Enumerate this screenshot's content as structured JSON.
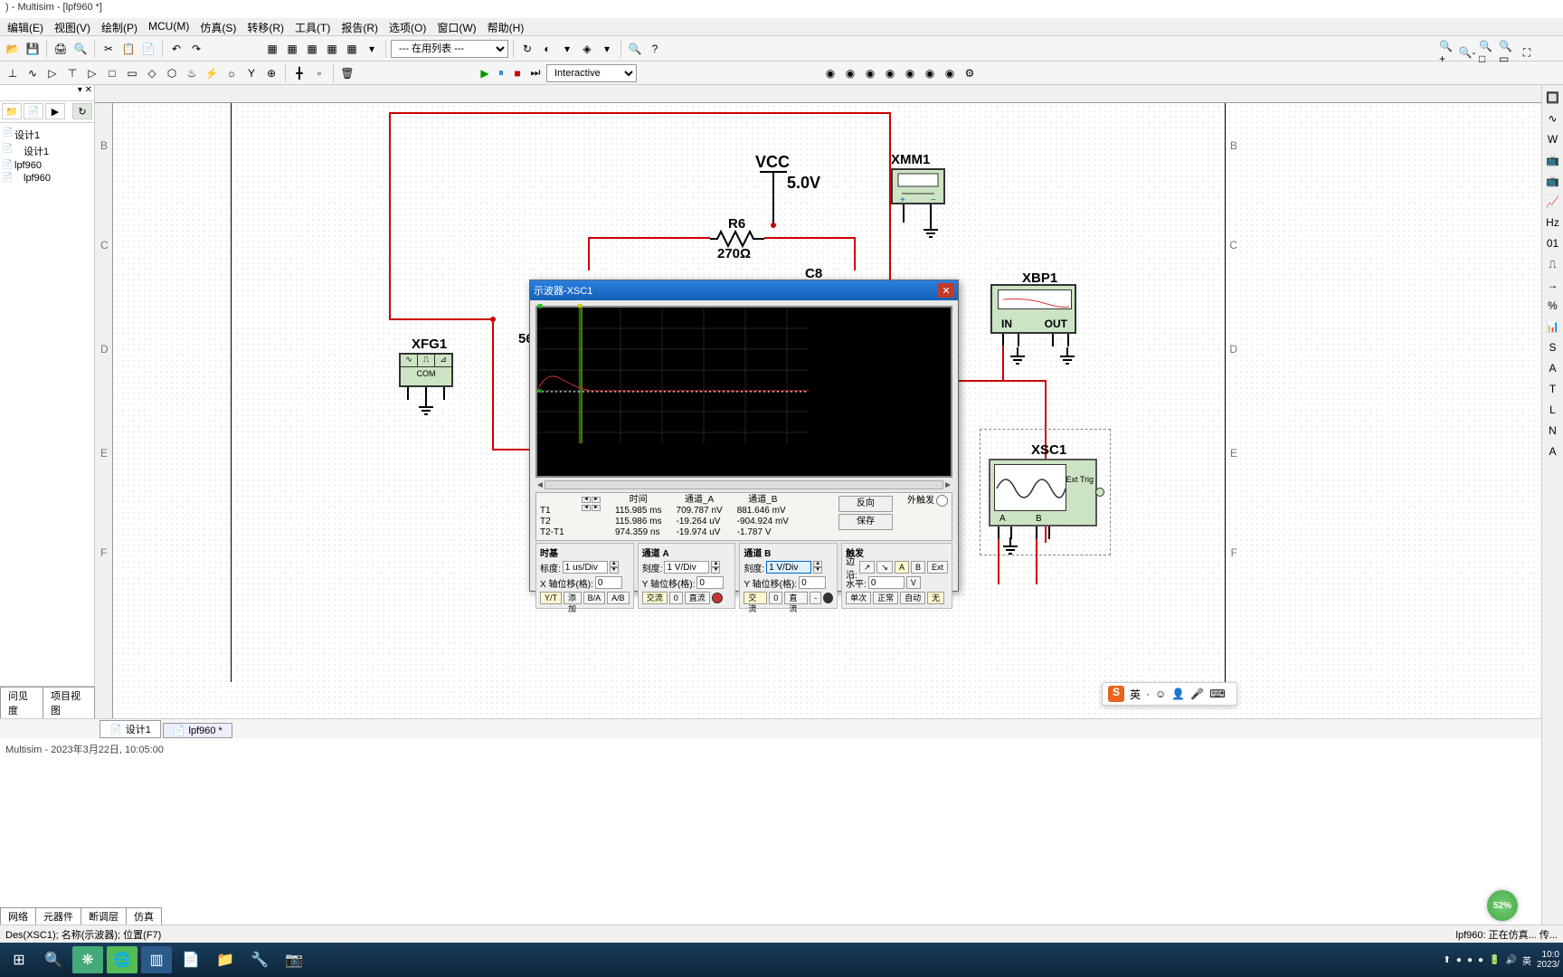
{
  "title": ") - Multisim - [lpf960 *]",
  "menu": [
    "编辑(E)",
    "视图(V)",
    "绘制(P)",
    "MCU(M)",
    "仿真(S)",
    "转移(R)",
    "工具(T)",
    "报告(R)",
    "选项(O)",
    "窗口(W)",
    "帮助(H)"
  ],
  "toolbar_dropdown": "--- 在用列表 ---",
  "sim_mode": "Interactive",
  "tree_items": [
    "设计1",
    "设计1",
    "lpf960",
    "lpf960"
  ],
  "sidebar_bottom_tabs": [
    "问见度",
    "项目视图"
  ],
  "bottom_tabs2": [
    "网络",
    "元器件",
    "断调层",
    "仿真"
  ],
  "file_tabs": [
    "设计1",
    "lpf960 *"
  ],
  "canvas_labels": {
    "vcc": "VCC",
    "vcc_val": "5.0V",
    "r6": "R6",
    "r6_val": "270Ω",
    "c8": "C8",
    "xfg1": "XFG1",
    "xmm1": "XMM1",
    "xbp1": "XBP1",
    "xsc1": "XSC1",
    "xbp1_in": "IN",
    "xbp1_out": "OUT",
    "xfg1_com": "COM",
    "row_labels": [
      "B",
      "C",
      "D",
      "E",
      "F"
    ],
    "node_56": "56",
    "xsc1_a": "A",
    "xsc1_b": "B",
    "xsc1_ext": "Ext Trig"
  },
  "scope": {
    "title": "示波器-XSC1",
    "readout": {
      "rows": [
        "T1",
        "T2",
        "T2-T1"
      ],
      "time_hdr": "时间",
      "ch_a_hdr": "通道_A",
      "ch_b_hdr": "通道_B",
      "time": [
        "115.985 ms",
        "115.986 ms",
        "974.359 ns"
      ],
      "ch_a": [
        "709.787 nV",
        "-19.264 uV",
        "-19.974 uV"
      ],
      "ch_b": [
        "881.646 mV",
        "-904.924 mV",
        "-1.787 V"
      ],
      "btn_reverse": "反向",
      "btn_save": "保存",
      "ext_trig": "外触发"
    },
    "timebase": {
      "title": "时基",
      "scale_lbl": "标度:",
      "scale": "1 us/Div",
      "xoff_lbl": "X 轴位移(格):",
      "xoff": "0",
      "btns": [
        "Y/T",
        "添加",
        "B/A",
        "A/B"
      ]
    },
    "cha": {
      "title": "通道 A",
      "scale_lbl": "刻度:",
      "scale": "1 V/Div",
      "yoff_lbl": "Y 轴位移(格):",
      "yoff": "0",
      "btns": [
        "交流",
        "0",
        "直流"
      ]
    },
    "chb": {
      "title": "通道 B",
      "scale_lbl": "刻度:",
      "scale": "1 V/Div",
      "yoff_lbl": "Y 轴位移(格):",
      "yoff": "0",
      "btns": [
        "交流",
        "0",
        "直流",
        "-"
      ]
    },
    "trig": {
      "title": "触发",
      "edge_lbl": "边沿:",
      "level_lbl": "水平:",
      "level": "0",
      "unit": "V",
      "btns": [
        "单次",
        "正常",
        "自动",
        "无"
      ],
      "edge_btns": [
        "↗",
        "↘",
        "A",
        "B",
        "Ext"
      ]
    }
  },
  "statusbar_left": "Des(XSC1); 名称(示波器); 位置(F7)",
  "statusbar_right": "lpf960: 正在仿真...      传...",
  "status_time": "Multisim  -  2023年3月22日, 10:05:00",
  "ime": {
    "lang": "英",
    "punct": "·"
  },
  "taskbar": {
    "time1": "10:0",
    "time2": "2023/"
  },
  "battery": "52%"
}
